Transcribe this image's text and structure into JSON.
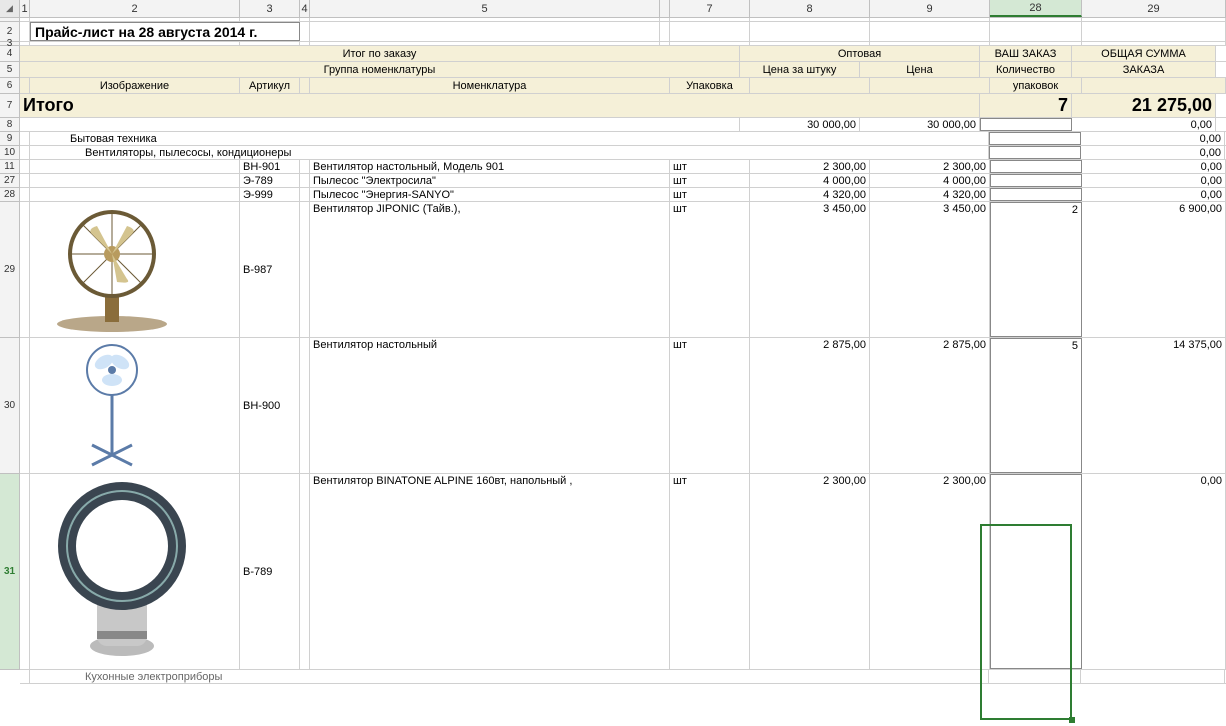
{
  "col_labels": {
    "c1": "1",
    "c2": "2",
    "c3": "3",
    "c4": "4",
    "c5": "5",
    "c6": "",
    "c7": "7",
    "c8": "8",
    "c9": "9",
    "c28": "28",
    "c29": "29"
  },
  "row_labels": [
    "2",
    "3",
    "4",
    "5",
    "6",
    "7",
    "8",
    "9",
    "10",
    "11",
    "27",
    "28",
    "29",
    "30",
    "31"
  ],
  "title": "Прайс-лист на 28 августа 2014 г.",
  "headers": {
    "itog_zakaz": "Итог по заказу",
    "optovaya": "Оптовая",
    "vash_zakaz": "ВАШ ЗАКАЗ",
    "obshaya_summa": "ОБЩАЯ СУММА",
    "gruppa": "Группа номенклатуры",
    "cena_shtuku": "Цена за штуку",
    "cena": "Цена",
    "kolichestvo": "Количество",
    "zakaza": "ЗАКАЗА",
    "izobrazhenie": "Изображение",
    "artikul": "Артикул",
    "nomenklatura": "Номенклатура",
    "upakovka": "Упаковка",
    "upakovok": "упаковок"
  },
  "totals": {
    "itogo_label": "Итого",
    "qty": "7",
    "sum": "21 275,00",
    "spacer1": "30 000,00",
    "spacer2": "30 000,00",
    "zero": "0,00"
  },
  "cat1": "Бытовая техника",
  "cat2": "Вентиляторы, пылесосы, кондиционеры",
  "rows": [
    {
      "art": "ВН-901",
      "name": "Вентилятор настольный, Модель 901",
      "unit": "шт",
      "p1": "2 300,00",
      "p2": "2 300,00",
      "qty": "",
      "sum": "0,00"
    },
    {
      "art": "Э-789",
      "name": "Пылесос \"Электросила\"",
      "unit": "шт",
      "p1": "4 000,00",
      "p2": "4 000,00",
      "qty": "",
      "sum": "0,00"
    },
    {
      "art": "Э-999",
      "name": "Пылесос \"Энергия-SANYO\"",
      "unit": "шт",
      "p1": "4 320,00",
      "p2": "4 320,00",
      "qty": "",
      "sum": "0,00"
    },
    {
      "art": "В-987",
      "name": "Вентилятор JIPONIC (Тайв.),",
      "unit": "шт",
      "p1": "3 450,00",
      "p2": "3 450,00",
      "qty": "2",
      "sum": "6 900,00"
    },
    {
      "art": "ВН-900",
      "name": "Вентилятор настольный",
      "unit": "шт",
      "p1": "2 875,00",
      "p2": "2 875,00",
      "qty": "5",
      "sum": "14 375,00"
    },
    {
      "art": "В-789",
      "name": "Вентилятор BINATONE ALPINE 160вт, напольный ,",
      "unit": "шт",
      "p1": "2 300,00",
      "p2": "2 300,00",
      "qty": "",
      "sum": "0,00"
    }
  ],
  "cat3": "Кухонные электроприборы"
}
